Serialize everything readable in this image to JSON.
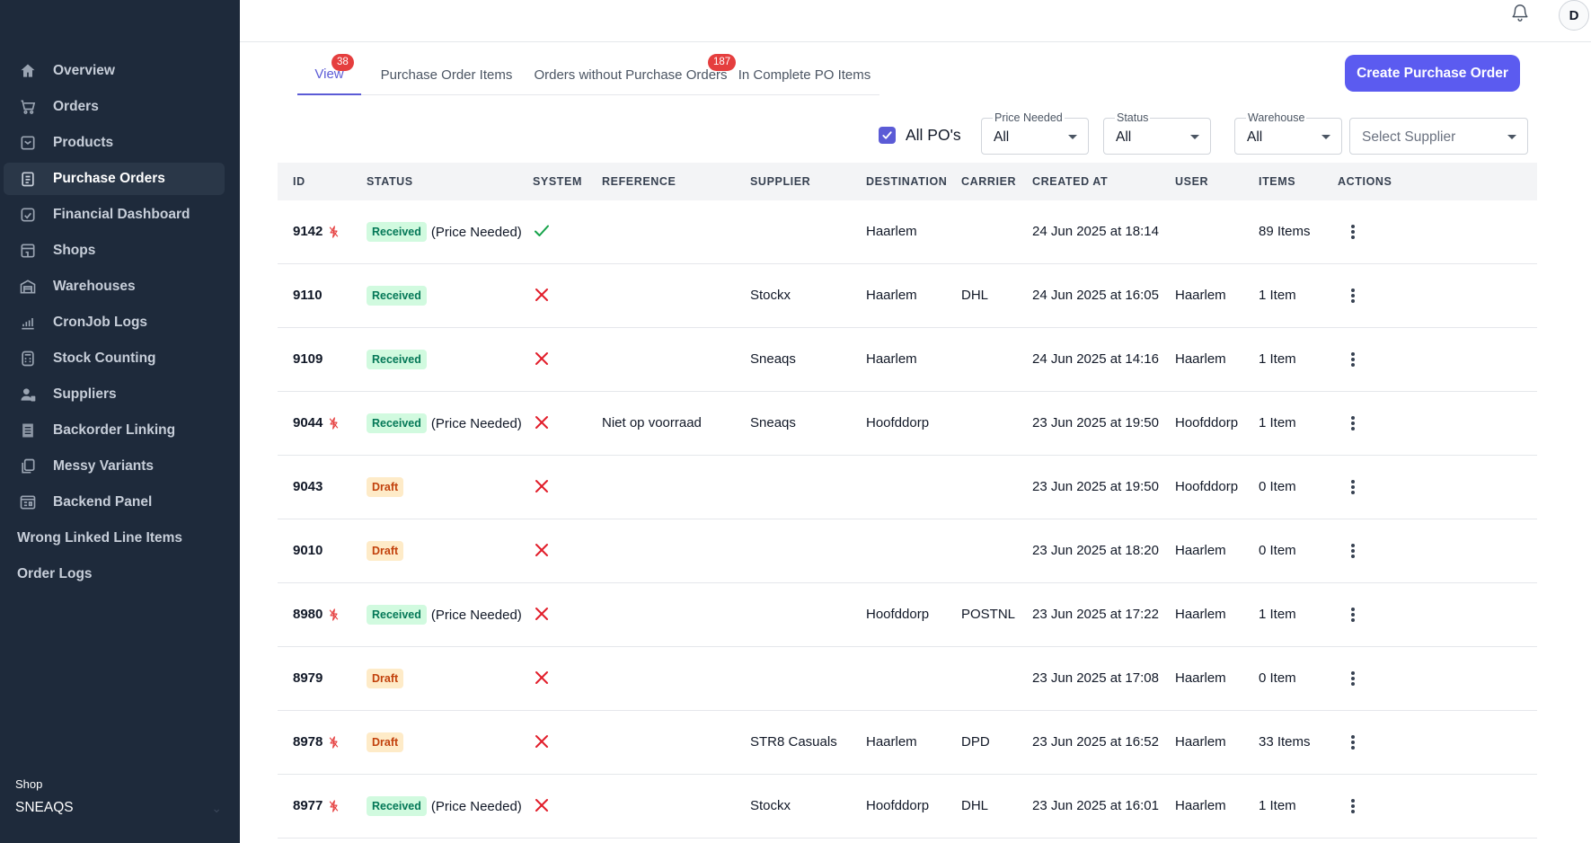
{
  "sidebar": {
    "items": [
      {
        "label": "Overview",
        "icon": "home-icon",
        "active": false
      },
      {
        "label": "Orders",
        "icon": "cart-icon",
        "active": false
      },
      {
        "label": "Products",
        "icon": "inbox-icon",
        "active": false
      },
      {
        "label": "Purchase Orders",
        "icon": "clipboard-icon",
        "active": true
      },
      {
        "label": "Financial Dashboard",
        "icon": "dashboard-icon",
        "active": false
      },
      {
        "label": "Shops",
        "icon": "shop-icon",
        "active": false
      },
      {
        "label": "Warehouses",
        "icon": "warehouse-icon",
        "active": false
      },
      {
        "label": "CronJob Logs",
        "icon": "chart-icon",
        "active": false
      },
      {
        "label": "Stock Counting",
        "icon": "calculator-icon",
        "active": false
      },
      {
        "label": "Suppliers",
        "icon": "user-box-icon",
        "active": false
      },
      {
        "label": "Backorder Linking",
        "icon": "list-icon",
        "active": false
      },
      {
        "label": "Messy Variants",
        "icon": "copy-icon",
        "active": false
      },
      {
        "label": "Backend Panel",
        "icon": "panel-icon",
        "active": false
      },
      {
        "label": "Wrong Linked Line Items",
        "icon": "",
        "active": false
      },
      {
        "label": "Order Logs",
        "icon": "",
        "active": false
      }
    ],
    "shop_label": "Shop",
    "shop_value": "SNEAQS"
  },
  "topbar": {
    "avatar_initial": "D"
  },
  "tabs": [
    {
      "label": "View",
      "badge": "38",
      "active": true
    },
    {
      "label": "Purchase Order Items",
      "badge": "",
      "active": false
    },
    {
      "label": "Orders without Purchase Orders",
      "badge": "187",
      "active": false
    },
    {
      "label": "In Complete PO Items",
      "badge": "",
      "active": false
    }
  ],
  "create_button": "Create Purchase Order",
  "filters": {
    "all_pos_label": "All PO's",
    "all_pos_checked": true,
    "price_needed": {
      "label": "Price Needed",
      "value": "All"
    },
    "status": {
      "label": "Status",
      "value": "All"
    },
    "warehouse": {
      "label": "Warehouse",
      "value": "All"
    },
    "supplier": {
      "placeholder": "Select Supplier"
    }
  },
  "table": {
    "headers": [
      "ID",
      "STATUS",
      "SYSTEM",
      "REFERENCE",
      "SUPPLIER",
      "DESTINATION",
      "CARRIER",
      "CREATED AT",
      "USER",
      "ITEMS",
      "ACTIONS"
    ],
    "rows": [
      {
        "id": "9142",
        "rush": true,
        "status": "Received",
        "price_needed": "(Price Needed)",
        "system": true,
        "reference": "",
        "supplier": "",
        "destination": "Haarlem",
        "carrier": "",
        "created_at": "24 Jun 2025 at 18:14",
        "user": "",
        "items": "89 Items"
      },
      {
        "id": "9110",
        "rush": false,
        "status": "Received",
        "price_needed": "",
        "system": false,
        "reference": "",
        "supplier": "Stockx",
        "destination": "Haarlem",
        "carrier": "DHL",
        "created_at": "24 Jun 2025 at 16:05",
        "user": "Haarlem",
        "items": "1 Item"
      },
      {
        "id": "9109",
        "rush": false,
        "status": "Received",
        "price_needed": "",
        "system": false,
        "reference": "",
        "supplier": "Sneaqs",
        "destination": "Haarlem",
        "carrier": "",
        "created_at": "24 Jun 2025 at 14:16",
        "user": "Haarlem",
        "items": "1 Item"
      },
      {
        "id": "9044",
        "rush": true,
        "status": "Received",
        "price_needed": "(Price Needed)",
        "system": false,
        "reference": "Niet op voorraad",
        "supplier": "Sneaqs",
        "destination": "Hoofddorp",
        "carrier": "",
        "created_at": "23 Jun 2025 at 19:50",
        "user": "Hoofddorp",
        "items": "1 Item"
      },
      {
        "id": "9043",
        "rush": false,
        "status": "Draft",
        "price_needed": "",
        "system": false,
        "reference": "",
        "supplier": "",
        "destination": "",
        "carrier": "",
        "created_at": "23 Jun 2025 at 19:50",
        "user": "Hoofddorp",
        "items": "0 Item"
      },
      {
        "id": "9010",
        "rush": false,
        "status": "Draft",
        "price_needed": "",
        "system": false,
        "reference": "",
        "supplier": "",
        "destination": "",
        "carrier": "",
        "created_at": "23 Jun 2025 at 18:20",
        "user": "Haarlem",
        "items": "0 Item"
      },
      {
        "id": "8980",
        "rush": true,
        "status": "Received",
        "price_needed": "(Price Needed)",
        "system": false,
        "reference": "",
        "supplier": "",
        "destination": "Hoofddorp",
        "carrier": "POSTNL",
        "created_at": "23 Jun 2025 at 17:22",
        "user": "Haarlem",
        "items": "1 Item"
      },
      {
        "id": "8979",
        "rush": false,
        "status": "Draft",
        "price_needed": "",
        "system": false,
        "reference": "",
        "supplier": "",
        "destination": "",
        "carrier": "",
        "created_at": "23 Jun 2025 at 17:08",
        "user": "Haarlem",
        "items": "0 Item"
      },
      {
        "id": "8978",
        "rush": true,
        "status": "Draft",
        "price_needed": "",
        "system": false,
        "reference": "",
        "supplier": "STR8 Casuals",
        "destination": "Haarlem",
        "carrier": "DPD",
        "created_at": "23 Jun 2025 at 16:52",
        "user": "Haarlem",
        "items": "33 Items"
      },
      {
        "id": "8977",
        "rush": true,
        "status": "Received",
        "price_needed": "(Price Needed)",
        "system": false,
        "reference": "",
        "supplier": "Stockx",
        "destination": "Hoofddorp",
        "carrier": "DHL",
        "created_at": "23 Jun 2025 at 16:01",
        "user": "Haarlem",
        "items": "1 Item"
      }
    ]
  },
  "colors": {
    "sidebar_bg": "#1e2a3b",
    "accent": "#5b5bf0",
    "badge_red": "#e53e3e",
    "received_bg": "#d1fadf",
    "draft_bg": "#feebc8",
    "system_ok": "#16a34a",
    "system_no": "#e11d2a"
  }
}
